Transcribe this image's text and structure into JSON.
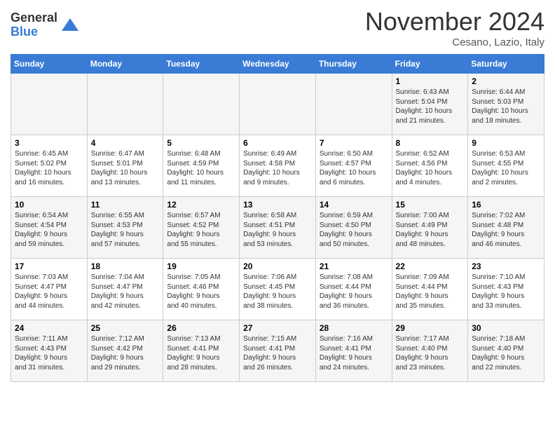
{
  "header": {
    "logo_general": "General",
    "logo_blue": "Blue",
    "month_title": "November 2024",
    "location": "Cesano, Lazio, Italy"
  },
  "days_of_week": [
    "Sunday",
    "Monday",
    "Tuesday",
    "Wednesday",
    "Thursday",
    "Friday",
    "Saturday"
  ],
  "weeks": [
    [
      {
        "day": "",
        "info": ""
      },
      {
        "day": "",
        "info": ""
      },
      {
        "day": "",
        "info": ""
      },
      {
        "day": "",
        "info": ""
      },
      {
        "day": "",
        "info": ""
      },
      {
        "day": "1",
        "info": "Sunrise: 6:43 AM\nSunset: 5:04 PM\nDaylight: 10 hours\nand 21 minutes."
      },
      {
        "day": "2",
        "info": "Sunrise: 6:44 AM\nSunset: 5:03 PM\nDaylight: 10 hours\nand 18 minutes."
      }
    ],
    [
      {
        "day": "3",
        "info": "Sunrise: 6:45 AM\nSunset: 5:02 PM\nDaylight: 10 hours\nand 16 minutes."
      },
      {
        "day": "4",
        "info": "Sunrise: 6:47 AM\nSunset: 5:01 PM\nDaylight: 10 hours\nand 13 minutes."
      },
      {
        "day": "5",
        "info": "Sunrise: 6:48 AM\nSunset: 4:59 PM\nDaylight: 10 hours\nand 11 minutes."
      },
      {
        "day": "6",
        "info": "Sunrise: 6:49 AM\nSunset: 4:58 PM\nDaylight: 10 hours\nand 9 minutes."
      },
      {
        "day": "7",
        "info": "Sunrise: 6:50 AM\nSunset: 4:57 PM\nDaylight: 10 hours\nand 6 minutes."
      },
      {
        "day": "8",
        "info": "Sunrise: 6:52 AM\nSunset: 4:56 PM\nDaylight: 10 hours\nand 4 minutes."
      },
      {
        "day": "9",
        "info": "Sunrise: 6:53 AM\nSunset: 4:55 PM\nDaylight: 10 hours\nand 2 minutes."
      }
    ],
    [
      {
        "day": "10",
        "info": "Sunrise: 6:54 AM\nSunset: 4:54 PM\nDaylight: 9 hours\nand 59 minutes."
      },
      {
        "day": "11",
        "info": "Sunrise: 6:55 AM\nSunset: 4:53 PM\nDaylight: 9 hours\nand 57 minutes."
      },
      {
        "day": "12",
        "info": "Sunrise: 6:57 AM\nSunset: 4:52 PM\nDaylight: 9 hours\nand 55 minutes."
      },
      {
        "day": "13",
        "info": "Sunrise: 6:58 AM\nSunset: 4:51 PM\nDaylight: 9 hours\nand 53 minutes."
      },
      {
        "day": "14",
        "info": "Sunrise: 6:59 AM\nSunset: 4:50 PM\nDaylight: 9 hours\nand 50 minutes."
      },
      {
        "day": "15",
        "info": "Sunrise: 7:00 AM\nSunset: 4:49 PM\nDaylight: 9 hours\nand 48 minutes."
      },
      {
        "day": "16",
        "info": "Sunrise: 7:02 AM\nSunset: 4:48 PM\nDaylight: 9 hours\nand 46 minutes."
      }
    ],
    [
      {
        "day": "17",
        "info": "Sunrise: 7:03 AM\nSunset: 4:47 PM\nDaylight: 9 hours\nand 44 minutes."
      },
      {
        "day": "18",
        "info": "Sunrise: 7:04 AM\nSunset: 4:47 PM\nDaylight: 9 hours\nand 42 minutes."
      },
      {
        "day": "19",
        "info": "Sunrise: 7:05 AM\nSunset: 4:46 PM\nDaylight: 9 hours\nand 40 minutes."
      },
      {
        "day": "20",
        "info": "Sunrise: 7:06 AM\nSunset: 4:45 PM\nDaylight: 9 hours\nand 38 minutes."
      },
      {
        "day": "21",
        "info": "Sunrise: 7:08 AM\nSunset: 4:44 PM\nDaylight: 9 hours\nand 36 minutes."
      },
      {
        "day": "22",
        "info": "Sunrise: 7:09 AM\nSunset: 4:44 PM\nDaylight: 9 hours\nand 35 minutes."
      },
      {
        "day": "23",
        "info": "Sunrise: 7:10 AM\nSunset: 4:43 PM\nDaylight: 9 hours\nand 33 minutes."
      }
    ],
    [
      {
        "day": "24",
        "info": "Sunrise: 7:11 AM\nSunset: 4:43 PM\nDaylight: 9 hours\nand 31 minutes."
      },
      {
        "day": "25",
        "info": "Sunrise: 7:12 AM\nSunset: 4:42 PM\nDaylight: 9 hours\nand 29 minutes."
      },
      {
        "day": "26",
        "info": "Sunrise: 7:13 AM\nSunset: 4:41 PM\nDaylight: 9 hours\nand 28 minutes."
      },
      {
        "day": "27",
        "info": "Sunrise: 7:15 AM\nSunset: 4:41 PM\nDaylight: 9 hours\nand 26 minutes."
      },
      {
        "day": "28",
        "info": "Sunrise: 7:16 AM\nSunset: 4:41 PM\nDaylight: 9 hours\nand 24 minutes."
      },
      {
        "day": "29",
        "info": "Sunrise: 7:17 AM\nSunset: 4:40 PM\nDaylight: 9 hours\nand 23 minutes."
      },
      {
        "day": "30",
        "info": "Sunrise: 7:18 AM\nSunset: 4:40 PM\nDaylight: 9 hours\nand 22 minutes."
      }
    ]
  ]
}
